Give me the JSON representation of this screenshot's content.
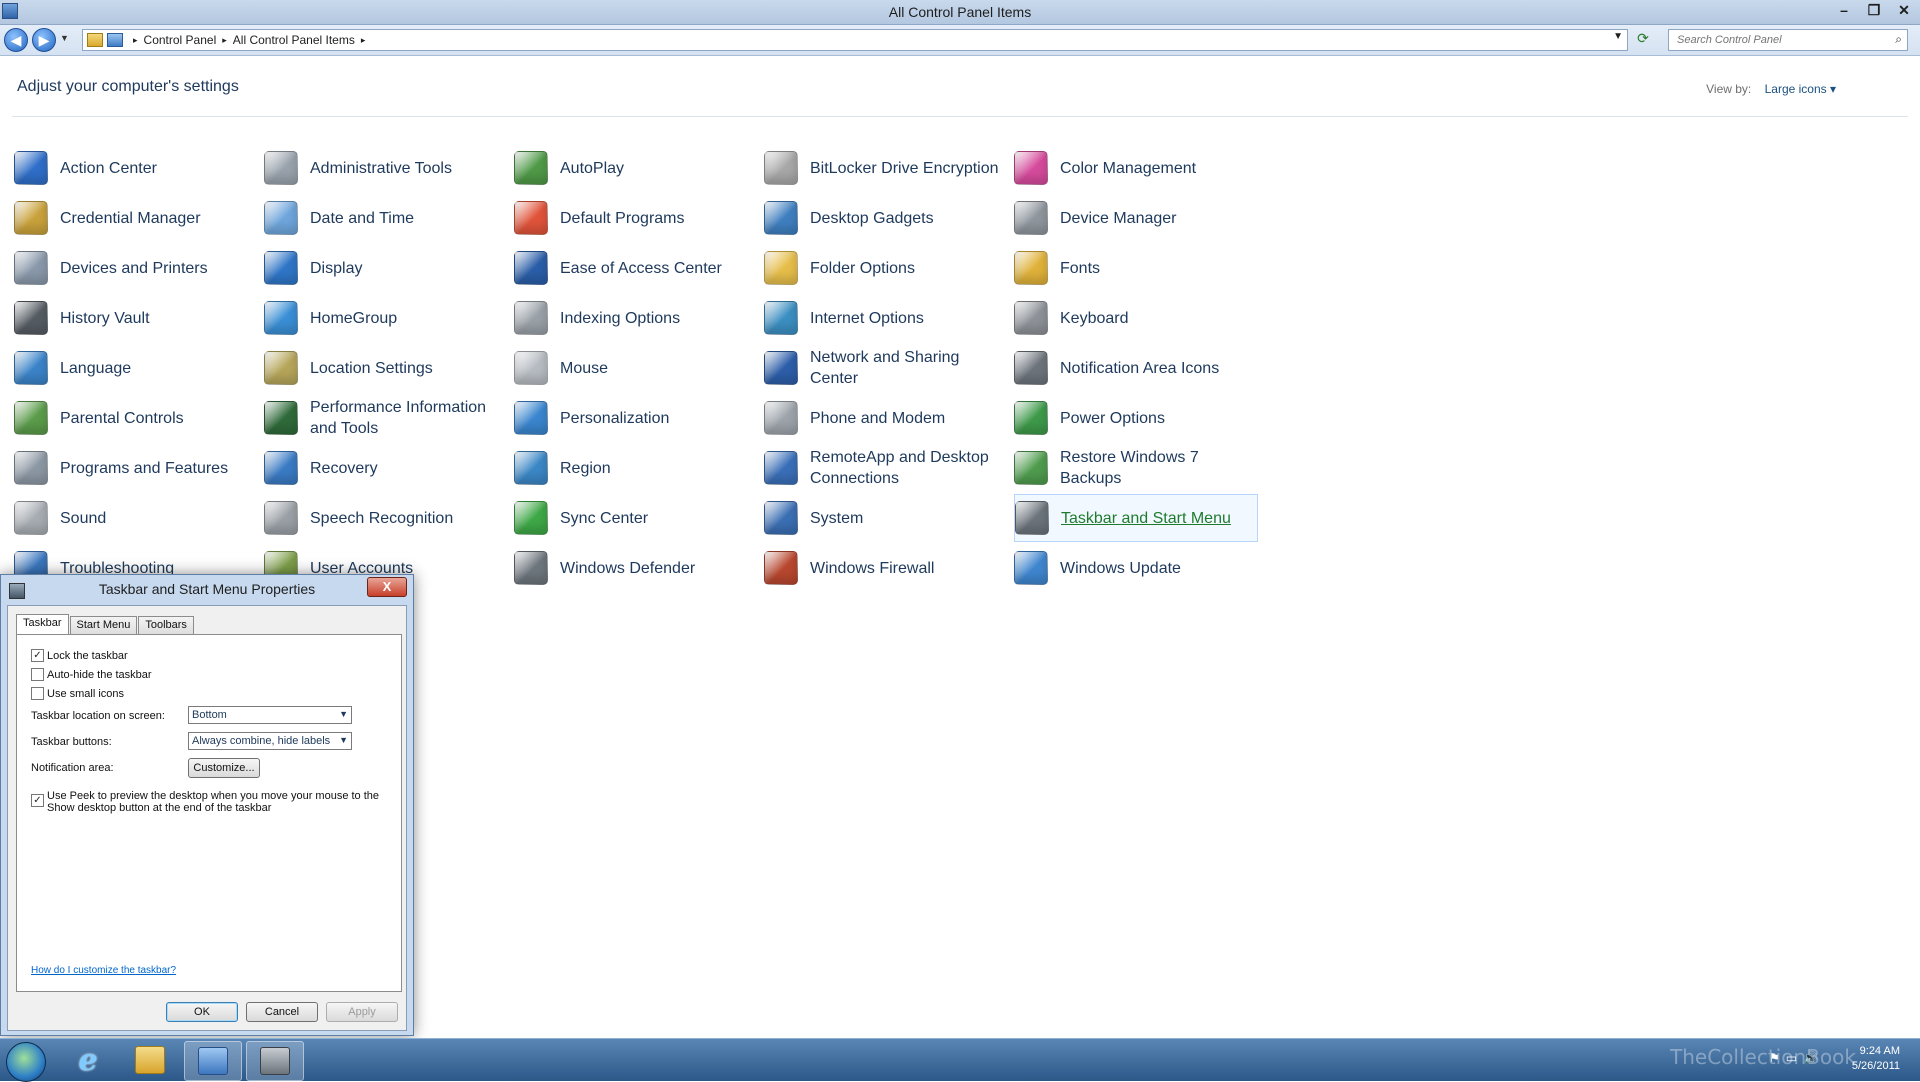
{
  "window": {
    "title": "All Control Panel Items"
  },
  "addressbar": {
    "crumbs": [
      "Control Panel",
      "All Control Panel Items"
    ],
    "search_placeholder": "Search Control Panel"
  },
  "content": {
    "heading": "Adjust your computer's settings",
    "view_by_label": "View by:",
    "view_by_value": "Large icons"
  },
  "items": [
    {
      "label": "Action Center",
      "icon": "flag-icon",
      "color": "#2f6fc9"
    },
    {
      "label": "Administrative Tools",
      "icon": "admin-tools-icon",
      "color": "#9aa3ad"
    },
    {
      "label": "AutoPlay",
      "icon": "autoplay-icon",
      "color": "#4f9a47"
    },
    {
      "label": "BitLocker Drive Encryption",
      "icon": "key-icon",
      "color": "#a8a8a8"
    },
    {
      "label": "Color Management",
      "icon": "color-management-icon",
      "color": "#d64b9c"
    },
    {
      "label": "Credential Manager",
      "icon": "vault-icon",
      "color": "#c9a23b"
    },
    {
      "label": "Date and Time",
      "icon": "calendar-clock-icon",
      "color": "#6fa6dc"
    },
    {
      "label": "Default Programs",
      "icon": "default-programs-icon",
      "color": "#e0543a"
    },
    {
      "label": "Desktop Gadgets",
      "icon": "gadgets-icon",
      "color": "#3f7fc0"
    },
    {
      "label": "Device Manager",
      "icon": "device-manager-icon",
      "color": "#8f969e"
    },
    {
      "label": "Devices and Printers",
      "icon": "printer-icon",
      "color": "#8a99ab"
    },
    {
      "label": "Display",
      "icon": "monitor-icon",
      "color": "#2f76c8"
    },
    {
      "label": "Ease of Access Center",
      "icon": "ease-of-access-icon",
      "color": "#2a5ea8"
    },
    {
      "label": "Folder Options",
      "icon": "folder-icon",
      "color": "#e6be4a"
    },
    {
      "label": "Fonts",
      "icon": "fonts-icon",
      "color": "#e0b23a"
    },
    {
      "label": "History Vault",
      "icon": "history-vault-icon",
      "color": "#555c63"
    },
    {
      "label": "HomeGroup",
      "icon": "homegroup-icon",
      "color": "#3a8fd6"
    },
    {
      "label": "Indexing Options",
      "icon": "indexing-icon",
      "color": "#9aa1a8"
    },
    {
      "label": "Internet Options",
      "icon": "globe-icon",
      "color": "#3c8fc2"
    },
    {
      "label": "Keyboard",
      "icon": "keyboard-icon",
      "color": "#8d9298"
    },
    {
      "label": "Language",
      "icon": "language-icon",
      "color": "#3b84c9"
    },
    {
      "label": "Location Settings",
      "icon": "location-icon",
      "color": "#b6a65a"
    },
    {
      "label": "Mouse",
      "icon": "mouse-icon",
      "color": "#b7bcc2"
    },
    {
      "label": "Network and Sharing Center",
      "icon": "network-icon",
      "color": "#2d5ea9"
    },
    {
      "label": "Notification Area Icons",
      "icon": "notification-icon",
      "color": "#6d747c"
    },
    {
      "label": "Parental Controls",
      "icon": "parental-controls-icon",
      "color": "#5b9c4a"
    },
    {
      "label": "Performance Information and Tools",
      "icon": "performance-icon",
      "color": "#2f6b3a"
    },
    {
      "label": "Personalization",
      "icon": "personalization-icon",
      "color": "#3a86cf"
    },
    {
      "label": "Phone and Modem",
      "icon": "phone-modem-icon",
      "color": "#9da4ab"
    },
    {
      "label": "Power Options",
      "icon": "power-icon",
      "color": "#3e9a4a"
    },
    {
      "label": "Programs and Features",
      "icon": "programs-icon",
      "color": "#8d98a5"
    },
    {
      "label": "Recovery",
      "icon": "recovery-icon",
      "color": "#3a7bc4"
    },
    {
      "label": "Region",
      "icon": "region-icon",
      "color": "#3b87c6"
    },
    {
      "label": "RemoteApp and Desktop Connections",
      "icon": "remoteapp-icon",
      "color": "#3a6fb8"
    },
    {
      "label": "Restore Windows 7 Backups",
      "icon": "restore-icon",
      "color": "#4f9c4e"
    },
    {
      "label": "Sound",
      "icon": "speaker-icon",
      "color": "#a7adb3"
    },
    {
      "label": "Speech Recognition",
      "icon": "microphone-icon",
      "color": "#9aa0a6"
    },
    {
      "label": "Sync Center",
      "icon": "sync-icon",
      "color": "#3ea846"
    },
    {
      "label": "System",
      "icon": "system-icon",
      "color": "#3b6fb4"
    },
    {
      "label": "Taskbar and Start Menu",
      "icon": "taskbar-icon",
      "color": "#6b737b",
      "selected": true
    },
    {
      "label": "Troubleshooting",
      "icon": "troubleshooting-icon",
      "color": "#3a77bf"
    },
    {
      "label": "User Accounts",
      "icon": "user-accounts-icon",
      "color": "#7fa04a"
    },
    {
      "label": "Windows Defender",
      "icon": "defender-icon",
      "color": "#6d757d"
    },
    {
      "label": "Windows Firewall",
      "icon": "firewall-icon",
      "color": "#b8472f"
    },
    {
      "label": "Windows Update",
      "icon": "windows-update-icon",
      "color": "#3f86cf"
    }
  ],
  "dialog": {
    "title": "Taskbar and Start Menu Properties",
    "close": "X",
    "tabs": [
      "Taskbar",
      "Start Menu",
      "Toolbars"
    ],
    "options": {
      "lock": "Lock the taskbar",
      "autohide": "Auto-hide the taskbar",
      "small_icons": "Use small icons",
      "location_label": "Taskbar location on screen:",
      "location_value": "Bottom",
      "buttons_label": "Taskbar buttons:",
      "buttons_value": "Always combine, hide labels",
      "notification_label": "Notification area:",
      "customize": "Customize...",
      "peek_line1": "Use Peek to preview the desktop when you move your mouse to the",
      "peek_line2": "Show desktop button at the end of the taskbar"
    },
    "checked": {
      "lock": true,
      "autohide": false,
      "small_icons": false,
      "peek": true
    },
    "help_link": "How do I customize the taskbar?",
    "ok": "OK",
    "cancel": "Cancel",
    "apply": "Apply"
  },
  "taskbar": {
    "watermark": "TheCollectionBook",
    "time": "9:24 AM",
    "date": "5/26/2011"
  }
}
